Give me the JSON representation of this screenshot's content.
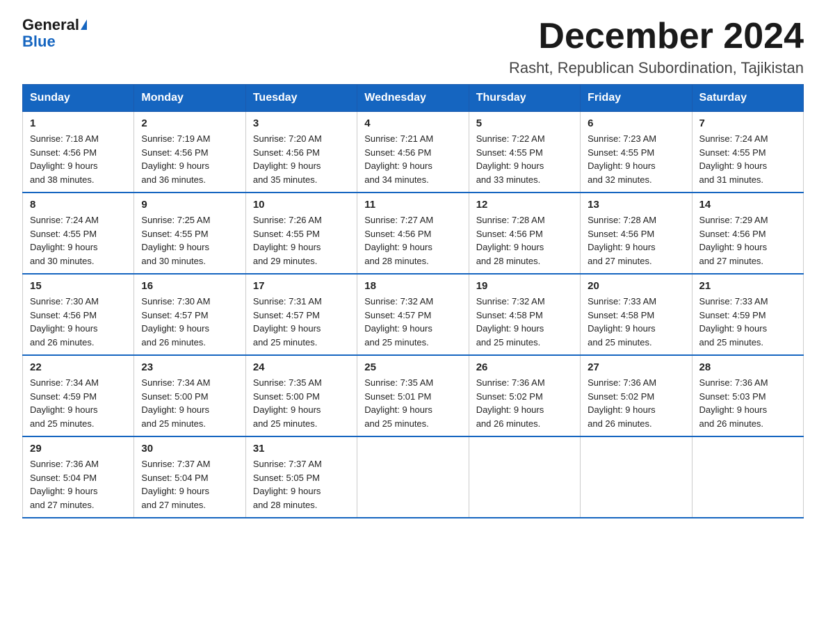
{
  "logo": {
    "general": "General",
    "blue": "Blue",
    "triangle": true
  },
  "header": {
    "title": "December 2024",
    "subtitle": "Rasht, Republican Subordination, Tajikistan"
  },
  "weekdays": [
    "Sunday",
    "Monday",
    "Tuesday",
    "Wednesday",
    "Thursday",
    "Friday",
    "Saturday"
  ],
  "weeks": [
    [
      {
        "day": 1,
        "sunrise": "7:18 AM",
        "sunset": "4:56 PM",
        "daylight": "9 hours and 38 minutes."
      },
      {
        "day": 2,
        "sunrise": "7:19 AM",
        "sunset": "4:56 PM",
        "daylight": "9 hours and 36 minutes."
      },
      {
        "day": 3,
        "sunrise": "7:20 AM",
        "sunset": "4:56 PM",
        "daylight": "9 hours and 35 minutes."
      },
      {
        "day": 4,
        "sunrise": "7:21 AM",
        "sunset": "4:56 PM",
        "daylight": "9 hours and 34 minutes."
      },
      {
        "day": 5,
        "sunrise": "7:22 AM",
        "sunset": "4:55 PM",
        "daylight": "9 hours and 33 minutes."
      },
      {
        "day": 6,
        "sunrise": "7:23 AM",
        "sunset": "4:55 PM",
        "daylight": "9 hours and 32 minutes."
      },
      {
        "day": 7,
        "sunrise": "7:24 AM",
        "sunset": "4:55 PM",
        "daylight": "9 hours and 31 minutes."
      }
    ],
    [
      {
        "day": 8,
        "sunrise": "7:24 AM",
        "sunset": "4:55 PM",
        "daylight": "9 hours and 30 minutes."
      },
      {
        "day": 9,
        "sunrise": "7:25 AM",
        "sunset": "4:55 PM",
        "daylight": "9 hours and 30 minutes."
      },
      {
        "day": 10,
        "sunrise": "7:26 AM",
        "sunset": "4:55 PM",
        "daylight": "9 hours and 29 minutes."
      },
      {
        "day": 11,
        "sunrise": "7:27 AM",
        "sunset": "4:56 PM",
        "daylight": "9 hours and 28 minutes."
      },
      {
        "day": 12,
        "sunrise": "7:28 AM",
        "sunset": "4:56 PM",
        "daylight": "9 hours and 28 minutes."
      },
      {
        "day": 13,
        "sunrise": "7:28 AM",
        "sunset": "4:56 PM",
        "daylight": "9 hours and 27 minutes."
      },
      {
        "day": 14,
        "sunrise": "7:29 AM",
        "sunset": "4:56 PM",
        "daylight": "9 hours and 27 minutes."
      }
    ],
    [
      {
        "day": 15,
        "sunrise": "7:30 AM",
        "sunset": "4:56 PM",
        "daylight": "9 hours and 26 minutes."
      },
      {
        "day": 16,
        "sunrise": "7:30 AM",
        "sunset": "4:57 PM",
        "daylight": "9 hours and 26 minutes."
      },
      {
        "day": 17,
        "sunrise": "7:31 AM",
        "sunset": "4:57 PM",
        "daylight": "9 hours and 25 minutes."
      },
      {
        "day": 18,
        "sunrise": "7:32 AM",
        "sunset": "4:57 PM",
        "daylight": "9 hours and 25 minutes."
      },
      {
        "day": 19,
        "sunrise": "7:32 AM",
        "sunset": "4:58 PM",
        "daylight": "9 hours and 25 minutes."
      },
      {
        "day": 20,
        "sunrise": "7:33 AM",
        "sunset": "4:58 PM",
        "daylight": "9 hours and 25 minutes."
      },
      {
        "day": 21,
        "sunrise": "7:33 AM",
        "sunset": "4:59 PM",
        "daylight": "9 hours and 25 minutes."
      }
    ],
    [
      {
        "day": 22,
        "sunrise": "7:34 AM",
        "sunset": "4:59 PM",
        "daylight": "9 hours and 25 minutes."
      },
      {
        "day": 23,
        "sunrise": "7:34 AM",
        "sunset": "5:00 PM",
        "daylight": "9 hours and 25 minutes."
      },
      {
        "day": 24,
        "sunrise": "7:35 AM",
        "sunset": "5:00 PM",
        "daylight": "9 hours and 25 minutes."
      },
      {
        "day": 25,
        "sunrise": "7:35 AM",
        "sunset": "5:01 PM",
        "daylight": "9 hours and 25 minutes."
      },
      {
        "day": 26,
        "sunrise": "7:36 AM",
        "sunset": "5:02 PM",
        "daylight": "9 hours and 26 minutes."
      },
      {
        "day": 27,
        "sunrise": "7:36 AM",
        "sunset": "5:02 PM",
        "daylight": "9 hours and 26 minutes."
      },
      {
        "day": 28,
        "sunrise": "7:36 AM",
        "sunset": "5:03 PM",
        "daylight": "9 hours and 26 minutes."
      }
    ],
    [
      {
        "day": 29,
        "sunrise": "7:36 AM",
        "sunset": "5:04 PM",
        "daylight": "9 hours and 27 minutes."
      },
      {
        "day": 30,
        "sunrise": "7:37 AM",
        "sunset": "5:04 PM",
        "daylight": "9 hours and 27 minutes."
      },
      {
        "day": 31,
        "sunrise": "7:37 AM",
        "sunset": "5:05 PM",
        "daylight": "9 hours and 28 minutes."
      },
      null,
      null,
      null,
      null
    ]
  ],
  "labels": {
    "sunrise": "Sunrise:",
    "sunset": "Sunset:",
    "daylight": "Daylight:"
  }
}
